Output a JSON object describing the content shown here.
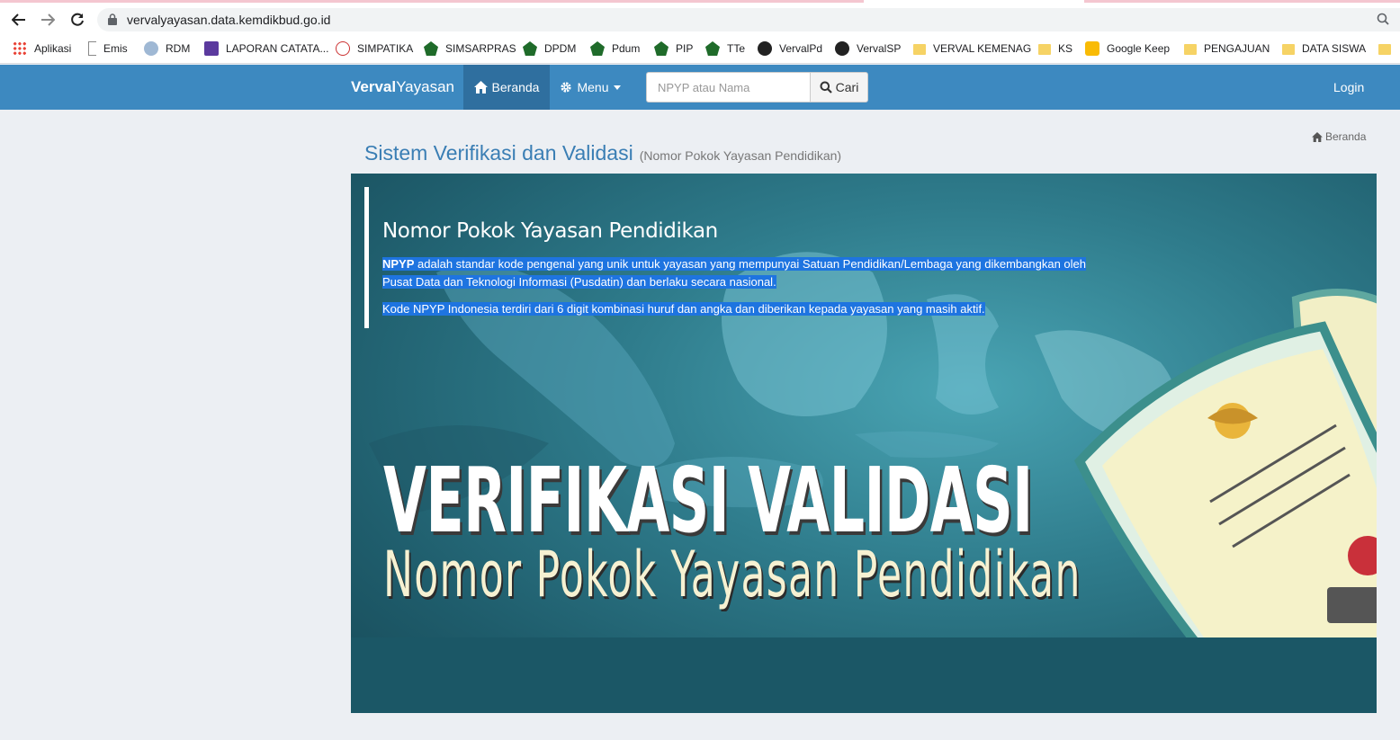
{
  "browser": {
    "url": "vervalyayasan.data.kemdikbud.go.id",
    "bookmarks": [
      {
        "label": "Aplikasi",
        "icon": "apps-grid-icon"
      },
      {
        "label": "Emis",
        "icon": "page-icon"
      },
      {
        "label": "RDM",
        "icon": "rdm-icon"
      },
      {
        "label": "LAPORAN CATATA...",
        "icon": "list-icon"
      },
      {
        "label": "SIMPATIKA",
        "icon": "simpatika-icon"
      },
      {
        "label": "SIMSARPRAS",
        "icon": "kemenag-icon"
      },
      {
        "label": "DPDM",
        "icon": "kemenag-icon"
      },
      {
        "label": "Pdum",
        "icon": "kemenag-icon"
      },
      {
        "label": "PIP",
        "icon": "kemenag-icon"
      },
      {
        "label": "TTe",
        "icon": "kemenag-icon"
      },
      {
        "label": "VervalPd",
        "icon": "globe-icon"
      },
      {
        "label": "VervalSP",
        "icon": "globe-icon"
      },
      {
        "label": "VERVAL KEMENAG",
        "icon": "folder-icon"
      },
      {
        "label": "KS",
        "icon": "folder-icon"
      },
      {
        "label": "Google Keep",
        "icon": "keep-icon"
      },
      {
        "label": "PENGAJUAN",
        "icon": "folder-icon"
      },
      {
        "label": "DATA SISWA",
        "icon": "folder-icon"
      }
    ]
  },
  "navbar": {
    "brand_bold": "Verval",
    "brand_rest": "Yayasan",
    "home_label": "Beranda",
    "menu_label": "Menu",
    "search_placeholder": "NPYP atau Nama",
    "search_button": "Cari",
    "login_label": "Login"
  },
  "breadcrumb": {
    "home": "Beranda"
  },
  "page": {
    "title": "Sistem Verifikasi dan Validasi",
    "subtitle": "(Nomor Pokok Yayasan Pendidikan)"
  },
  "banner": {
    "heading": "Nomor Pokok Yayasan Pendidikan",
    "para1_bold": "NPYP",
    "para1_rest": " adalah standar kode pengenal yang unik untuk yayasan yang mempunyai Satuan Pendidikan/Lembaga yang dikembangkan oleh",
    "para1_line2": "Pusat Data dan Teknologi Informasi (Pusdatin) dan berlaku secara nasional.",
    "para2": "Kode NPYP Indonesia terdiri dari 6 digit kombinasi huruf dan angka dan diberikan kepada yayasan yang masih aktif.",
    "big_line1": "VERIFIKASI VALIDASI",
    "big_line2": "Nomor Pokok Yayasan Pendidikan"
  },
  "colors": {
    "navbar": "#3d89c0",
    "navbar_active": "#2f6f9f",
    "title": "#3a7eb4",
    "highlight": "#1e74e0"
  }
}
